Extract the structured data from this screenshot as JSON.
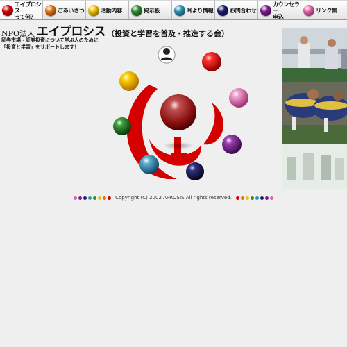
{
  "nav": {
    "tabs": [
      {
        "label": "エイプロシス\nって何？",
        "color": "#d40000",
        "name": "nav-tab-about",
        "active": true
      },
      {
        "label": "ごあいさつ",
        "color": "#e07010",
        "name": "nav-tab-greeting"
      },
      {
        "label": "活動内容",
        "color": "#f0c000",
        "name": "nav-tab-activities"
      },
      {
        "label": "掲示板",
        "color": "#2e8a2e",
        "name": "nav-tab-bbs"
      },
      {
        "label": "耳より情報",
        "color": "#2f8fb0",
        "name": "nav-tab-info"
      },
      {
        "label": "お問合わせ",
        "color": "#1a1a70",
        "name": "nav-tab-contact"
      },
      {
        "label": "カウンセラー\n申込",
        "color": "#7a1a8a",
        "name": "nav-tab-counselor"
      },
      {
        "label": "リンク集",
        "color": "#e060a8",
        "name": "nav-tab-links"
      }
    ]
  },
  "header": {
    "prefix": "NPO法人",
    "name": "エイプロシス",
    "subtitle": "（投資と学習を普及・推進する会）",
    "tagline": [
      "証券市場・証券投資について学ぶ人のために",
      "「投資と学習」をサポートします！"
    ]
  },
  "footer": {
    "copyright": "Copyright (C) 2002 APROSIS All rights reserved.",
    "dot_colors": [
      "#e060a8",
      "#7a1a8a",
      "#1a1a70",
      "#2f8fb0",
      "#2e8a2e",
      "#f0c000",
      "#e07010",
      "#d40000"
    ]
  },
  "colors": {
    "background": "#efefef",
    "logo_red": "#d40000"
  }
}
